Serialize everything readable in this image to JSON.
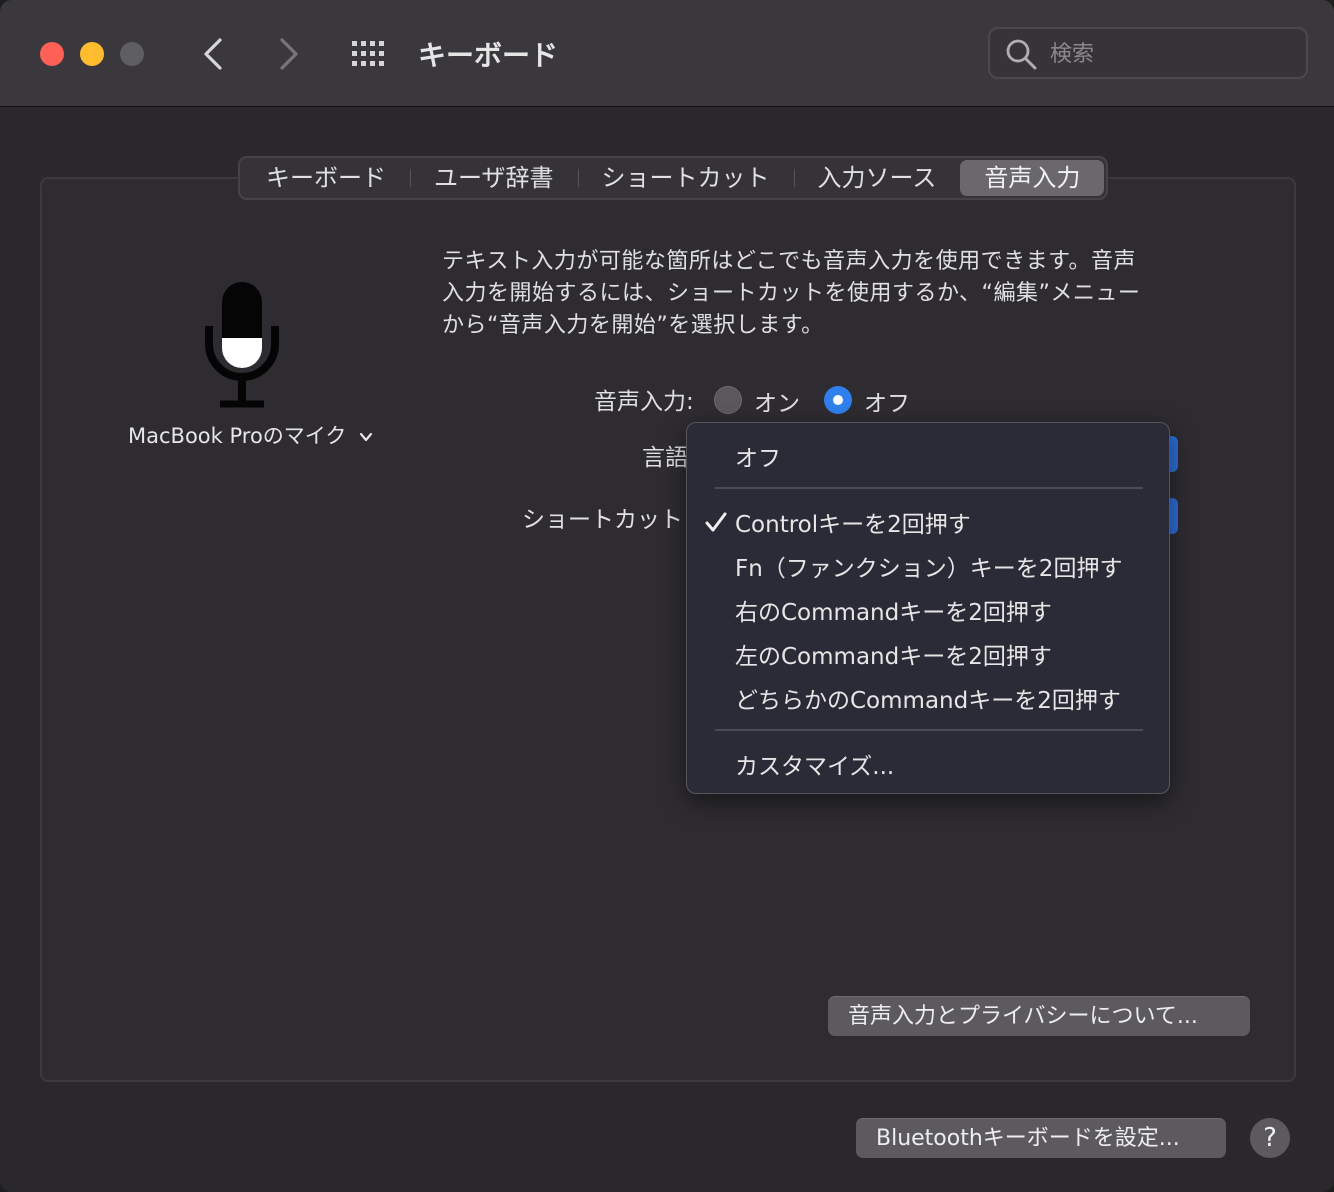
{
  "window": {
    "title": "キーボード",
    "search_placeholder": "検索"
  },
  "tabs": [
    {
      "label": "キーボード"
    },
    {
      "label": "ユーザ辞書"
    },
    {
      "label": "ショートカット"
    },
    {
      "label": "入力ソース"
    },
    {
      "label": "音声入力",
      "active": true
    }
  ],
  "mic": {
    "source_label": "MacBook Proのマイク"
  },
  "dictation": {
    "description_lines": [
      "テキスト入力が可能な箇所はどこでも音声入力を使用できます。音声",
      "入力を開始するには、ショートカットを使用するか、“編集”メニュー",
      "から“音声入力を開始”を選択します。"
    ],
    "label": "音声入力:",
    "option_on": "オン",
    "option_off": "オフ",
    "selected": "オフ",
    "language_label": "言語",
    "shortcut_label": "ショートカット"
  },
  "shortcut_menu": {
    "items": [
      "オフ",
      "Controlキーを2回押す",
      "Fn（ファンクション）キーを2回押す",
      "右のCommandキーを2回押す",
      "左のCommandキーを2回押す",
      "どちらかのCommandキーを2回押す",
      "カスタマイズ..."
    ],
    "checked": "Controlキーを2回押す"
  },
  "buttons": {
    "privacy": "音声入力とプライバシーについて...",
    "bluetooth": "Bluetoothキーボードを設定...",
    "help": "?"
  },
  "colors": {
    "accent": "#2f80ed",
    "close": "#fe5f57",
    "minimize": "#febc2e",
    "zoom_disabled": "#5f5e62"
  }
}
